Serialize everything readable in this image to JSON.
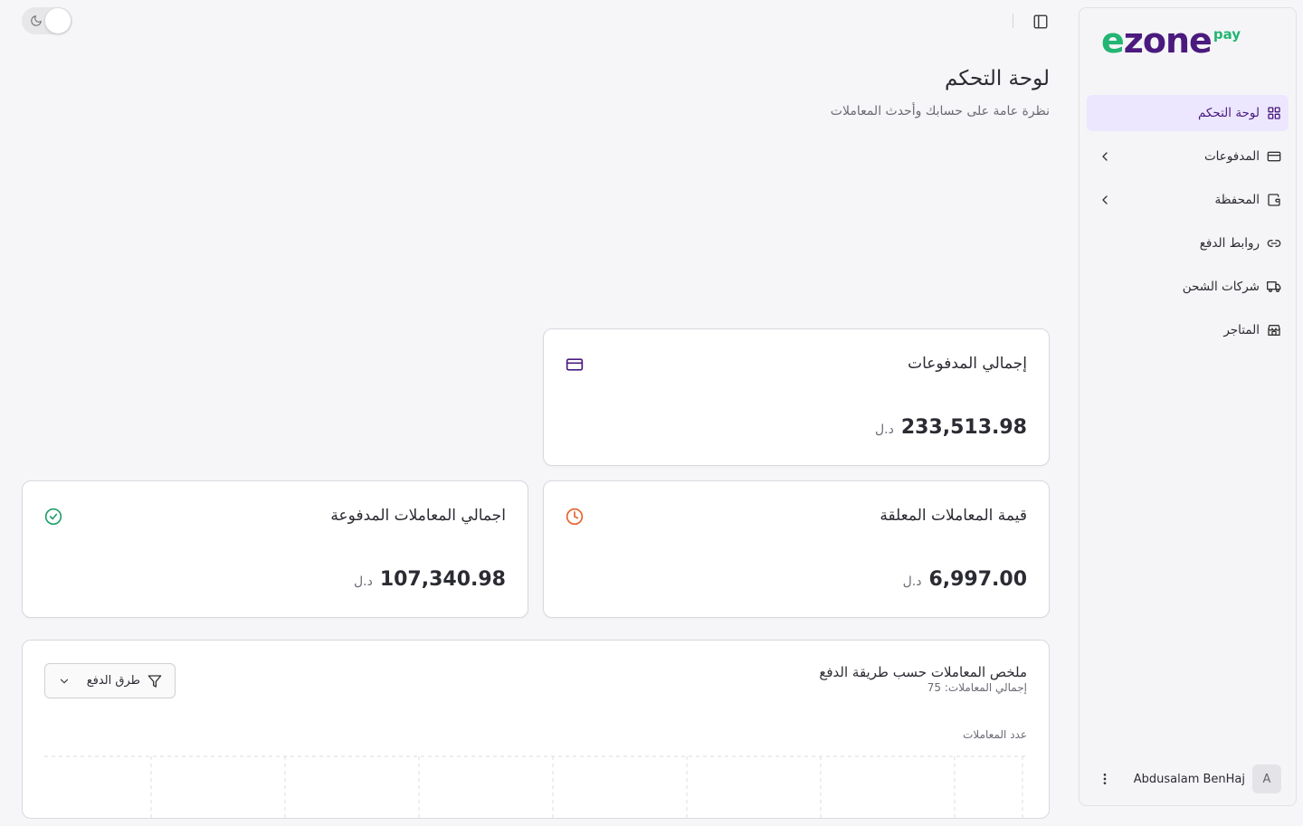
{
  "app": {
    "logo": {
      "e": "e",
      "zone": "zone",
      "pay": "pay"
    }
  },
  "sidebar": {
    "items": [
      {
        "label": "لوحة التحكم",
        "icon": "dashboard-grid-icon",
        "active": true,
        "has_submenu": false
      },
      {
        "label": "المدفوعات",
        "icon": "credit-card-icon",
        "active": false,
        "has_submenu": true
      },
      {
        "label": "المحفظة",
        "icon": "wallet-icon",
        "active": false,
        "has_submenu": true
      },
      {
        "label": "روابط الدفع",
        "icon": "link-icon",
        "active": false,
        "has_submenu": false
      },
      {
        "label": "شركات الشحن",
        "icon": "truck-icon",
        "active": false,
        "has_submenu": false
      },
      {
        "label": "المتاجر",
        "icon": "store-icon",
        "active": false,
        "has_submenu": false
      }
    ],
    "user": {
      "name": "Abdusalam BenHaj",
      "initial": "A"
    }
  },
  "header": {
    "title": "لوحة التحكم",
    "subtitle": "نظرة عامة على حسابك وأحدث المعاملات"
  },
  "cards": {
    "total_payments": {
      "title": "إجمالي المدفوعات",
      "value": "233,513.98",
      "currency": "د.ل",
      "icon": "credit-card-icon"
    },
    "pending_value": {
      "title": "قيمة المعاملات المعلقة",
      "value": "6,997.00",
      "currency": "د.ل",
      "icon": "clock-icon"
    },
    "paid_total": {
      "title": "اجمالي المعاملات المدفوعة",
      "value": "107,340.98",
      "currency": "د.ل",
      "icon": "check-circle-icon"
    }
  },
  "summary": {
    "title": "ملخص المعاملات حسب طريقة الدفع",
    "subtitle": "إجمالي المعاملات: 75",
    "filter_label": "طرق الدفع",
    "axis_label": "عدد المعاملات"
  },
  "colors": {
    "brand_green": "#22b573",
    "brand_purple": "#4a1a7e",
    "active_bg": "#ece7ff",
    "pending_orange": "#e8622c",
    "success_green": "#22a06b"
  }
}
